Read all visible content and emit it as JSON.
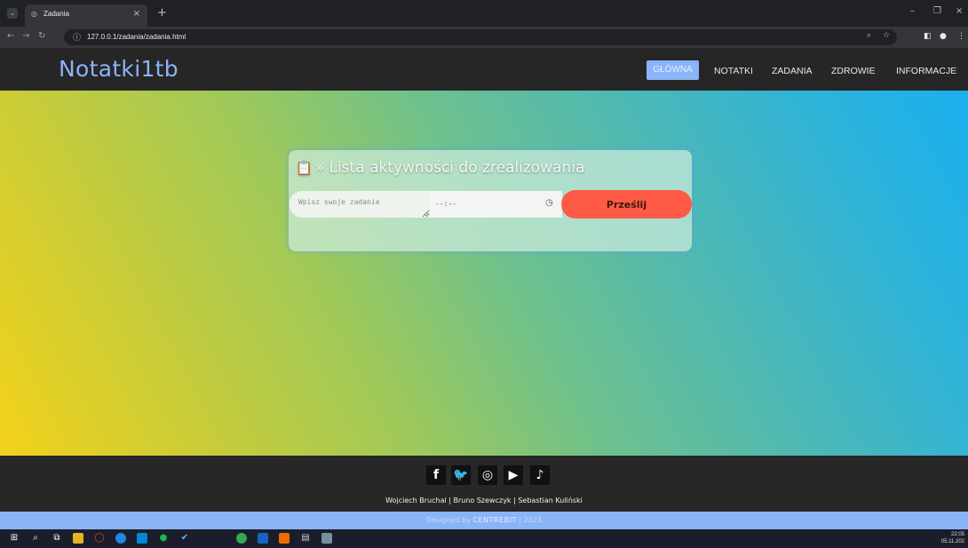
{
  "browser": {
    "tab_title": "Zadania",
    "tab_close": "×",
    "new_tab": "+",
    "url": "127.0.0.1/zadania/zadania.html",
    "minimize": "–",
    "restore": "❐",
    "close": "×"
  },
  "site": {
    "logo": "Notatki1tb",
    "nav": [
      {
        "label": "GŁÓWNA",
        "active": true
      },
      {
        "label": "NOTATKI"
      },
      {
        "label": "ZADANIA"
      },
      {
        "label": "ZDROWIE"
      },
      {
        "label": "INFORMACJE"
      }
    ]
  },
  "card": {
    "title": "» Lista aktywności do zrealizowania",
    "input_placeholder": "Wpisz swoje zadanie",
    "time_value": "--:--",
    "submit_label": "Prześlij"
  },
  "footer": {
    "social": [
      {
        "icon": "facebook-icon",
        "glyph": "f"
      },
      {
        "icon": "twitter-icon",
        "glyph": "🐦"
      },
      {
        "icon": "instagram-icon",
        "glyph": "◎"
      },
      {
        "icon": "youtube-icon",
        "glyph": "▶"
      },
      {
        "icon": "tiktok-icon",
        "glyph": "♪"
      }
    ],
    "authors": "Wojciech Bruchal | Bruno Szewczyk | Sebastian Kuliński",
    "designed_prefix": "Designed by",
    "designed_brand": "CENTREBIT",
    "designed_year": "| 2023"
  },
  "taskbar": {
    "time": "22:05",
    "date": "05.11.202"
  },
  "colors": {
    "accent": "#8ab4f8",
    "submit": "#ff5a45",
    "header_bg": "#262626"
  }
}
